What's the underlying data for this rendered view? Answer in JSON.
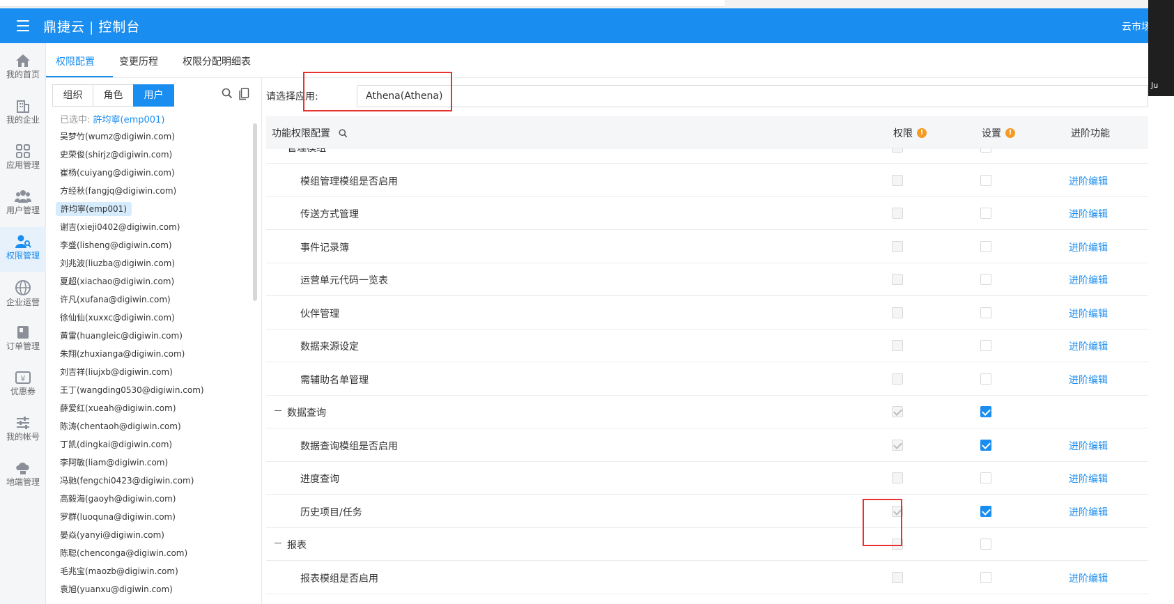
{
  "header": {
    "brand": "鼎捷云",
    "console": "控制台",
    "right": "云市场"
  },
  "overlay": {
    "text": "Ju"
  },
  "nav": [
    {
      "icon": "home-icon",
      "label": "我的首页"
    },
    {
      "icon": "building-icon",
      "label": "我的企业"
    },
    {
      "icon": "apps-grid-icon",
      "label": "应用管理"
    },
    {
      "icon": "users-icon",
      "label": "用户管理"
    },
    {
      "icon": "user-key-icon",
      "label": "权限管理",
      "active": true
    },
    {
      "icon": "globe-icon",
      "label": "企业运营"
    },
    {
      "icon": "order-book-icon",
      "label": "订单管理"
    },
    {
      "icon": "coupon-icon",
      "label": "优惠券"
    },
    {
      "icon": "sliders-icon",
      "label": "我的帐号"
    },
    {
      "icon": "cloud-device-icon",
      "label": "地端管理"
    }
  ],
  "tabs": [
    "权限配置",
    "变更历程",
    "权限分配明细表"
  ],
  "panel": {
    "segments": [
      "组织",
      "角色",
      "用户"
    ],
    "selected_label": "已选中:",
    "selected_value": "許均寧(emp001)",
    "users": [
      "吴梦竹(wumz@digiwin.com)",
      "史荣俊(shirjz@digiwin.com)",
      "崔杨(cuiyang@digiwin.com)",
      "方经秋(fangjq@digiwin.com)",
      "許均寧(emp001)",
      "谢吉(xieji0402@digiwin.com)",
      "李盛(lisheng@digiwin.com)",
      "刘兆波(liuzba@digiwin.com)",
      "夏超(xiachao@digiwin.com)",
      "许凡(xufana@digiwin.com)",
      "徐仙仙(xuxxc@digiwin.com)",
      "黄雷(huangleic@digiwin.com)",
      "朱翔(zhuxianga@digiwin.com)",
      "刘吉祥(liujxb@digiwin.com)",
      "王丁(wangding0530@digiwin.com)",
      "薛爱红(xueah@digiwin.com)",
      "陈涛(chentaoh@digiwin.com)",
      "丁凯(dingkai@digiwin.com)",
      "李阿敏(liam@digiwin.com)",
      "冯驰(fengchi0423@digiwin.com)",
      "高毅海(gaoyh@digiwin.com)",
      "罗群(luoquna@digiwin.com)",
      "晏焱(yanyi@digiwin.com)",
      "陈聪(chenconga@digiwin.com)",
      "毛兆宝(maozb@digiwin.com)",
      "袁旭(yuanxu@digiwin.com)"
    ],
    "selected_index": 4
  },
  "main": {
    "app_label": "请选择应用:",
    "app_value": "Athena(Athena)",
    "col_func": "功能权限配置",
    "col_perm": "权限",
    "col_set": "设置",
    "col_adv": "进阶功能",
    "advanced_link": "进阶编辑",
    "rows": [
      {
        "name": "管理模组",
        "group": true,
        "perm": false,
        "set": false,
        "link": false
      },
      {
        "name": "模组管理模组是否启用",
        "group": false,
        "perm": false,
        "set": false,
        "link": true
      },
      {
        "name": "传送方式管理",
        "group": false,
        "perm": false,
        "set": false,
        "link": true
      },
      {
        "name": "事件记录簿",
        "group": false,
        "perm": false,
        "set": false,
        "link": true
      },
      {
        "name": "运营单元代码一览表",
        "group": false,
        "perm": false,
        "set": false,
        "link": true
      },
      {
        "name": "伙伴管理",
        "group": false,
        "perm": false,
        "set": false,
        "link": true
      },
      {
        "name": "数据来源设定",
        "group": false,
        "perm": false,
        "set": false,
        "link": true
      },
      {
        "name": "需辅助名单管理",
        "group": false,
        "perm": false,
        "set": false,
        "link": true
      },
      {
        "name": "数据查询",
        "group": true,
        "perm": true,
        "set": true,
        "link": false
      },
      {
        "name": "数据查询模组是否启用",
        "group": false,
        "perm": true,
        "set": true,
        "link": true
      },
      {
        "name": "进度查询",
        "group": false,
        "perm": false,
        "set": false,
        "link": true
      },
      {
        "name": "历史项目/任务",
        "group": false,
        "perm": true,
        "set": true,
        "link": true
      },
      {
        "name": "报表",
        "group": true,
        "perm": false,
        "set": false,
        "link": false
      },
      {
        "name": "报表模组是否启用",
        "group": false,
        "perm": false,
        "set": false,
        "link": true
      }
    ]
  },
  "colors": {
    "primary": "#1a8df0",
    "highlight": "#e8322f",
    "warning": "#f59a23"
  }
}
